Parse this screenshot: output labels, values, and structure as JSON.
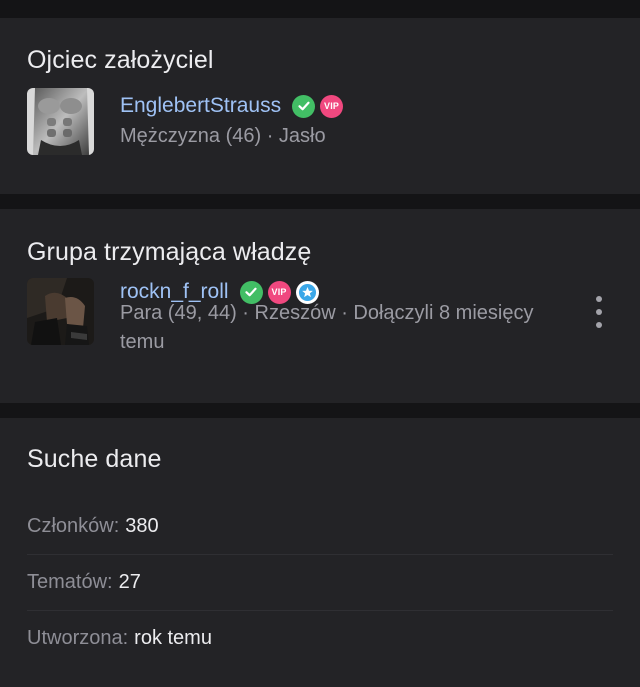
{
  "sections": {
    "founder": {
      "title": "Ojciec założyciel",
      "user": {
        "username": "EnglebertStrauss",
        "meta": "Mężczyzna (46) · Jasło",
        "badges": [
          "verified-icon",
          "vip-badge"
        ]
      }
    },
    "ruling_group": {
      "title": "Grupa trzymająca władzę",
      "user": {
        "username": "rockn_f_roll",
        "meta": "Para (49, 44) · Rzeszów · Dołączyli 8 miesięcy temu",
        "badges": [
          "verified-icon",
          "vip-badge",
          "star-icon"
        ]
      }
    },
    "stats": {
      "title": "Suche dane",
      "rows": [
        {
          "label": "Członków:",
          "value": "380"
        },
        {
          "label": "Tematów:",
          "value": "27"
        },
        {
          "label": "Utworzona:",
          "value": "rok temu"
        }
      ]
    }
  },
  "badge_text": {
    "vip": "VIP"
  },
  "colors": {
    "background": "#141416",
    "card": "#232326",
    "username": "#9fc2f5",
    "verified": "#42be65",
    "vip": "#f0487f",
    "star": "#3aa7e8",
    "muted_text": "#9b9ba3"
  },
  "icons": {
    "more": "more-vertical-icon"
  }
}
